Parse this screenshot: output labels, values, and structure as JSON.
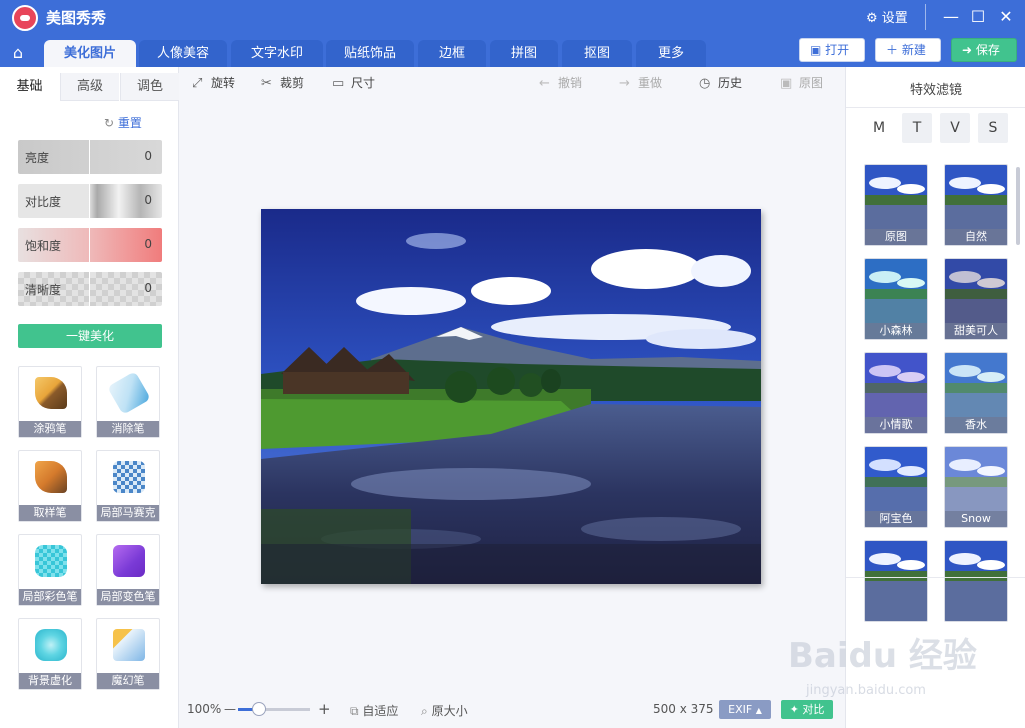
{
  "app": {
    "title": "美图秀秀",
    "settings_label": "设置"
  },
  "tabs": [
    {
      "label": "美化图片",
      "active": true
    },
    {
      "label": "人像美容"
    },
    {
      "label": "文字水印"
    },
    {
      "label": "贴纸饰品"
    },
    {
      "label": "边框"
    },
    {
      "label": "拼图"
    },
    {
      "label": "抠图"
    },
    {
      "label": "更多"
    }
  ],
  "top_buttons": {
    "open": "打开",
    "new": "新建",
    "save": "保存"
  },
  "left_panel": {
    "subtabs": [
      "基础",
      "高级",
      "调色"
    ],
    "reset_label": "重置",
    "sliders": [
      {
        "label": "亮度",
        "value": "0"
      },
      {
        "label": "对比度",
        "value": "0"
      },
      {
        "label": "饱和度",
        "value": "0"
      },
      {
        "label": "清晰度",
        "value": "0"
      }
    ],
    "oneclick_label": "一键美化",
    "tools": [
      {
        "label": "涂鸦笔",
        "icon": "brush-icon"
      },
      {
        "label": "消除笔",
        "icon": "eraser-icon"
      },
      {
        "label": "取样笔",
        "icon": "sample-brush-icon"
      },
      {
        "label": "局部马赛克",
        "icon": "mosaic-pen-icon"
      },
      {
        "label": "局部彩色笔",
        "icon": "color-pen-icon"
      },
      {
        "label": "局部变色笔",
        "icon": "recolor-pen-icon"
      },
      {
        "label": "背景虚化",
        "icon": "blur-background-icon"
      },
      {
        "label": "魔幻笔",
        "icon": "magic-pen-icon"
      }
    ]
  },
  "toolbar": {
    "rotate": "旋转",
    "crop": "裁剪",
    "size": "尺寸",
    "undo": "撤销",
    "redo": "重做",
    "history": "历史",
    "original": "原图"
  },
  "bottom_bar": {
    "zoom": "100%",
    "fit": "自适应",
    "actual_size": "原大小",
    "dimensions": "500 x 375",
    "exif": "EXIF",
    "compare": "对比",
    "zoom_level": 0.25
  },
  "right_panel": {
    "title": "特效滤镜",
    "categories": [
      "M",
      "T",
      "V",
      "S"
    ],
    "filters": [
      {
        "label": "原图"
      },
      {
        "label": "自然"
      },
      {
        "label": "小森林"
      },
      {
        "label": "甜美可人"
      },
      {
        "label": "小情歌"
      },
      {
        "label": "香水"
      },
      {
        "label": "阿宝色"
      },
      {
        "label": "Snow"
      },
      {
        "label": ""
      },
      {
        "label": ""
      }
    ]
  },
  "watermark": {
    "text": "Baidu 经验",
    "sub": "jingyan.baidu.com"
  },
  "colors": {
    "accent": "#3d6ed8",
    "green": "#41c38e"
  }
}
